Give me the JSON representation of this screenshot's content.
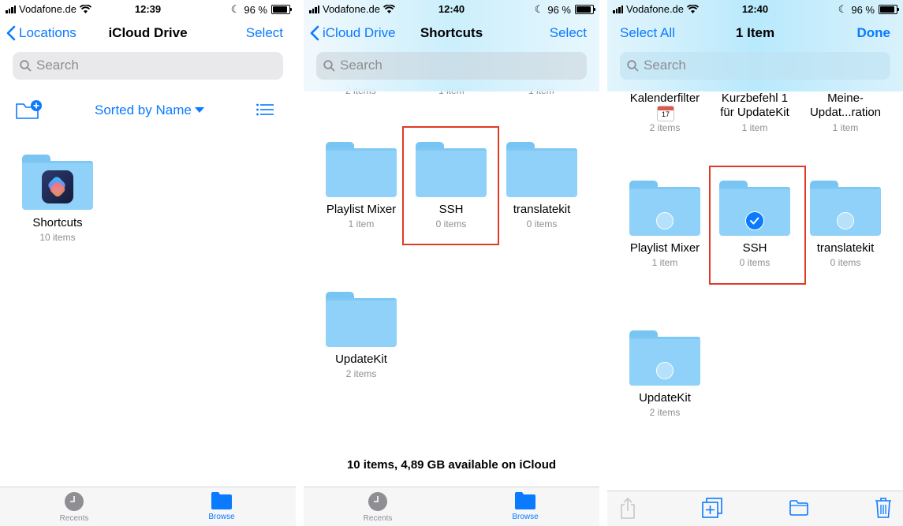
{
  "screen1": {
    "status": {
      "carrier": "Vodafone.de",
      "time": "12:39",
      "battery": "96 %"
    },
    "nav": {
      "back": "Locations",
      "title": "iCloud Drive",
      "action": "Select"
    },
    "search": {
      "placeholder": "Search"
    },
    "sort_label": "Sorted by Name",
    "folders": [
      {
        "name": "Shortcuts",
        "count": "10 items"
      }
    ],
    "tabs": [
      {
        "label": "Recents"
      },
      {
        "label": "Browse"
      }
    ]
  },
  "screen2": {
    "status": {
      "carrier": "Vodafone.de",
      "time": "12:40",
      "battery": "96 %"
    },
    "nav": {
      "back": "iCloud Drive",
      "title": "Shortcuts",
      "action": "Select"
    },
    "search": {
      "placeholder": "Search"
    },
    "partial_counts": [
      "2 items",
      "1 item",
      "1 item"
    ],
    "folders": [
      {
        "name": "Playlist Mixer",
        "count": "1 item"
      },
      {
        "name": "SSH",
        "count": "0 items"
      },
      {
        "name": "translatekit",
        "count": "0 items"
      },
      {
        "name": "UpdateKit",
        "count": "2 items"
      }
    ],
    "footer": "10 items, 4,89 GB available on iCloud",
    "tabs": [
      {
        "label": "Recents"
      },
      {
        "label": "Browse"
      }
    ]
  },
  "screen3": {
    "status": {
      "carrier": "Vodafone.de",
      "time": "12:40",
      "battery": "96 %"
    },
    "nav": {
      "left": "Select All",
      "title": "1 Item",
      "action": "Done"
    },
    "search": {
      "placeholder": "Search"
    },
    "top_items": [
      {
        "name": "Kalenderfilter",
        "count": "2 items"
      },
      {
        "name": "Kurzbefehl 1\nfür UpdateKit",
        "count": "1 item"
      },
      {
        "name": "Meine-\nUpdat...ration",
        "count": "1 item"
      }
    ],
    "calendar_day": "17",
    "folders": [
      {
        "name": "Playlist Mixer",
        "count": "1 item"
      },
      {
        "name": "SSH",
        "count": "0 items"
      },
      {
        "name": "translatekit",
        "count": "0 items"
      },
      {
        "name": "UpdateKit",
        "count": "2 items"
      }
    ]
  },
  "colors": {
    "accent": "#0a7aff",
    "highlight": "#e03a24",
    "folder": "#8fd1f8"
  }
}
